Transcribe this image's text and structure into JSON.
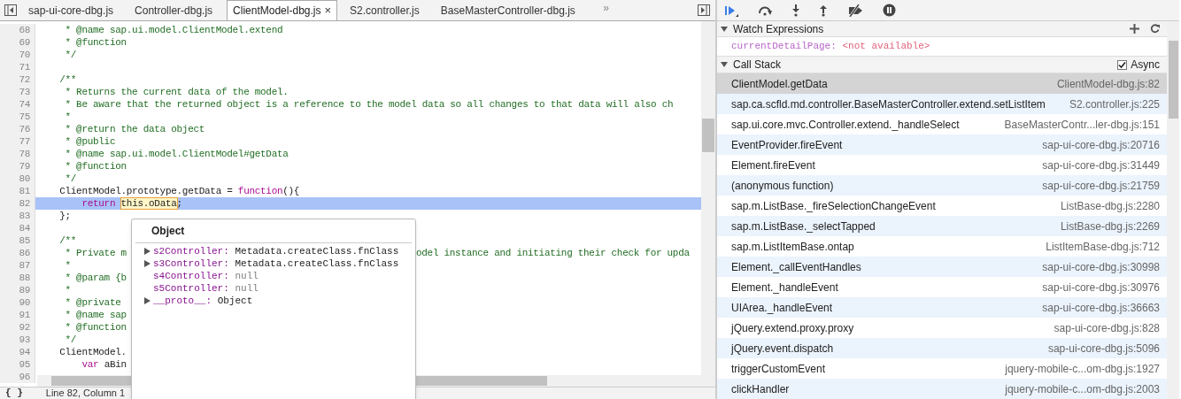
{
  "tabs": [
    {
      "label": "sap-ui-core-dbg.js",
      "selected": false
    },
    {
      "label": "Controller-dbg.js",
      "selected": false
    },
    {
      "label": "ClientModel-dbg.js",
      "selected": true,
      "close_icon": "×"
    },
    {
      "label": "S2.controller.js",
      "selected": false
    },
    {
      "label": "BaseMasterController-dbg.js",
      "selected": false
    }
  ],
  "tabs_overflow": "»",
  "code_lines": [
    {
      "number": "68",
      "tokens": [
        {
          "kind": "comment",
          "text": "     * @name sap.ui.model.ClientModel.extend"
        }
      ]
    },
    {
      "number": "69",
      "tokens": [
        {
          "kind": "comment",
          "text": "     * @function"
        }
      ]
    },
    {
      "number": "70",
      "tokens": [
        {
          "kind": "comment",
          "text": "     */"
        }
      ]
    },
    {
      "number": "71"
    },
    {
      "number": "72",
      "tokens": [
        {
          "kind": "comment",
          "text": "    /**"
        }
      ]
    },
    {
      "number": "73",
      "tokens": [
        {
          "kind": "comment",
          "text": "     * Returns the current data of the model."
        }
      ]
    },
    {
      "number": "74",
      "tokens": [
        {
          "kind": "comment",
          "text": "     * Be aware that the returned object is a reference to the model data so all changes to that data will also ch"
        }
      ]
    },
    {
      "number": "75",
      "tokens": [
        {
          "kind": "comment",
          "text": "     *"
        }
      ]
    },
    {
      "number": "76",
      "tokens": [
        {
          "kind": "comment",
          "text": "     * @return the data object"
        }
      ]
    },
    {
      "number": "77",
      "tokens": [
        {
          "kind": "comment",
          "text": "     * @public"
        }
      ]
    },
    {
      "number": "78",
      "tokens": [
        {
          "kind": "comment",
          "text": "     * @name sap.ui.model.ClientModel#getData"
        }
      ]
    },
    {
      "number": "79",
      "tokens": [
        {
          "kind": "comment",
          "text": "     * @function"
        }
      ]
    },
    {
      "number": "80",
      "tokens": [
        {
          "kind": "comment",
          "text": "     */"
        }
      ]
    },
    {
      "number": "81",
      "tokens": [
        {
          "kind": "plain",
          "text": "    ClientModel.prototype.getData = "
        },
        {
          "kind": "keyword",
          "text": "function"
        },
        {
          "kind": "plain",
          "text": "(){"
        }
      ]
    },
    {
      "number": "82",
      "selected": true,
      "tokens": [
        {
          "kind": "keyword",
          "text": "        return "
        },
        {
          "kind": "match",
          "text": "this.oData"
        },
        {
          "kind": "plain",
          "text": ";"
        }
      ]
    },
    {
      "number": "83",
      "tokens": [
        {
          "kind": "plain",
          "text": "    };"
        }
      ]
    },
    {
      "number": "84"
    },
    {
      "number": "85",
      "tokens": [
        {
          "kind": "comment",
          "text": "    /**"
        }
      ]
    },
    {
      "number": "86",
      "tokens": [
        {
          "kind": "comment",
          "text": "     * Private m"
        }
      ],
      "tail": [
        {
          "kind": "comment",
          "text": "odel instance and initiating their check for upda"
        }
      ]
    },
    {
      "number": "87",
      "tokens": [
        {
          "kind": "comment",
          "text": "     *"
        }
      ]
    },
    {
      "number": "88",
      "tokens": [
        {
          "kind": "comment",
          "text": "     * @param {b"
        }
      ]
    },
    {
      "number": "89",
      "tokens": [
        {
          "kind": "comment",
          "text": "     *"
        }
      ]
    },
    {
      "number": "90",
      "tokens": [
        {
          "kind": "comment",
          "text": "     * @private"
        }
      ]
    },
    {
      "number": "91",
      "tokens": [
        {
          "kind": "comment",
          "text": "     * @name sap"
        }
      ]
    },
    {
      "number": "92",
      "tokens": [
        {
          "kind": "comment",
          "text": "     * @function"
        }
      ]
    },
    {
      "number": "93",
      "tokens": [
        {
          "kind": "comment",
          "text": "     */"
        }
      ]
    },
    {
      "number": "94",
      "tokens": [
        {
          "kind": "plain",
          "text": "    ClientModel."
        }
      ]
    },
    {
      "number": "95",
      "tokens": [
        {
          "kind": "keyword",
          "text": "        var "
        },
        {
          "kind": "plain",
          "text": "aBin"
        }
      ]
    },
    {
      "number": "96"
    }
  ],
  "popover": {
    "title": "Object",
    "properties": [
      {
        "name": "s2Controller:",
        "value": "Metadata.createClass.fnClass",
        "expandable": true,
        "dimmed": false
      },
      {
        "name": "s3Controller:",
        "value": "Metadata.createClass.fnClass",
        "expandable": true,
        "dimmed": false
      },
      {
        "name": "s4Controller:",
        "value": "null",
        "expandable": false,
        "dimmed": true
      },
      {
        "name": "s5Controller:",
        "value": "null",
        "expandable": false,
        "dimmed": true
      },
      {
        "name": "__proto__:",
        "value": "Object",
        "expandable": true,
        "dimmed": false
      }
    ]
  },
  "status_bar": {
    "format_button": "{ }",
    "position": "Line 82, Column 1"
  },
  "watch": {
    "title": "Watch Expressions",
    "expanded": true,
    "items": [
      {
        "expression": "currentDetailPage:",
        "value": "<not available>"
      }
    ]
  },
  "call_stack": {
    "title": "Call Stack",
    "expanded": true,
    "async_label": "Async",
    "async_checked": true,
    "frames": [
      {
        "function": "ClientModel.getData",
        "location": "ClientModel-dbg.js:82",
        "selected": true
      },
      {
        "function": "sap.ca.scfld.md.controller.BaseMasterController.extend.setListItem",
        "location": "S2.controller.js:225",
        "selected": false
      },
      {
        "function": "sap.ui.core.mvc.Controller.extend._handleSelect",
        "location": "BaseMasterContr...ler-dbg.js:151",
        "selected": false
      },
      {
        "function": "EventProvider.fireEvent",
        "location": "sap-ui-core-dbg.js:20716",
        "selected": false
      },
      {
        "function": "Element.fireEvent",
        "location": "sap-ui-core-dbg.js:31449",
        "selected": false
      },
      {
        "function": "(anonymous function)",
        "location": "sap-ui-core-dbg.js:21759",
        "selected": false
      },
      {
        "function": "sap.m.ListBase._fireSelectionChangeEvent",
        "location": "ListBase-dbg.js:2280",
        "selected": false
      },
      {
        "function": "sap.m.ListBase._selectTapped",
        "location": "ListBase-dbg.js:2269",
        "selected": false
      },
      {
        "function": "sap.m.ListItemBase.ontap",
        "location": "ListItemBase-dbg.js:712",
        "selected": false
      },
      {
        "function": "Element._callEventHandles",
        "location": "sap-ui-core-dbg.js:30998",
        "selected": false
      },
      {
        "function": "Element._handleEvent",
        "location": "sap-ui-core-dbg.js:30976",
        "selected": false
      },
      {
        "function": "UIArea._handleEvent",
        "location": "sap-ui-core-dbg.js:36663",
        "selected": false
      },
      {
        "function": "jQuery.extend.proxy.proxy",
        "location": "sap-ui-core-dbg.js:828",
        "selected": false
      },
      {
        "function": "jQuery.event.dispatch",
        "location": "sap-ui-core-dbg.js:5096",
        "selected": false
      },
      {
        "function": "triggerCustomEvent",
        "location": "jquery-mobile-c...om-dbg.js:1927",
        "selected": false
      },
      {
        "function": "clickHandler",
        "location": "jquery-mobile-c...om-dbg.js:2003",
        "selected": false
      }
    ]
  }
}
